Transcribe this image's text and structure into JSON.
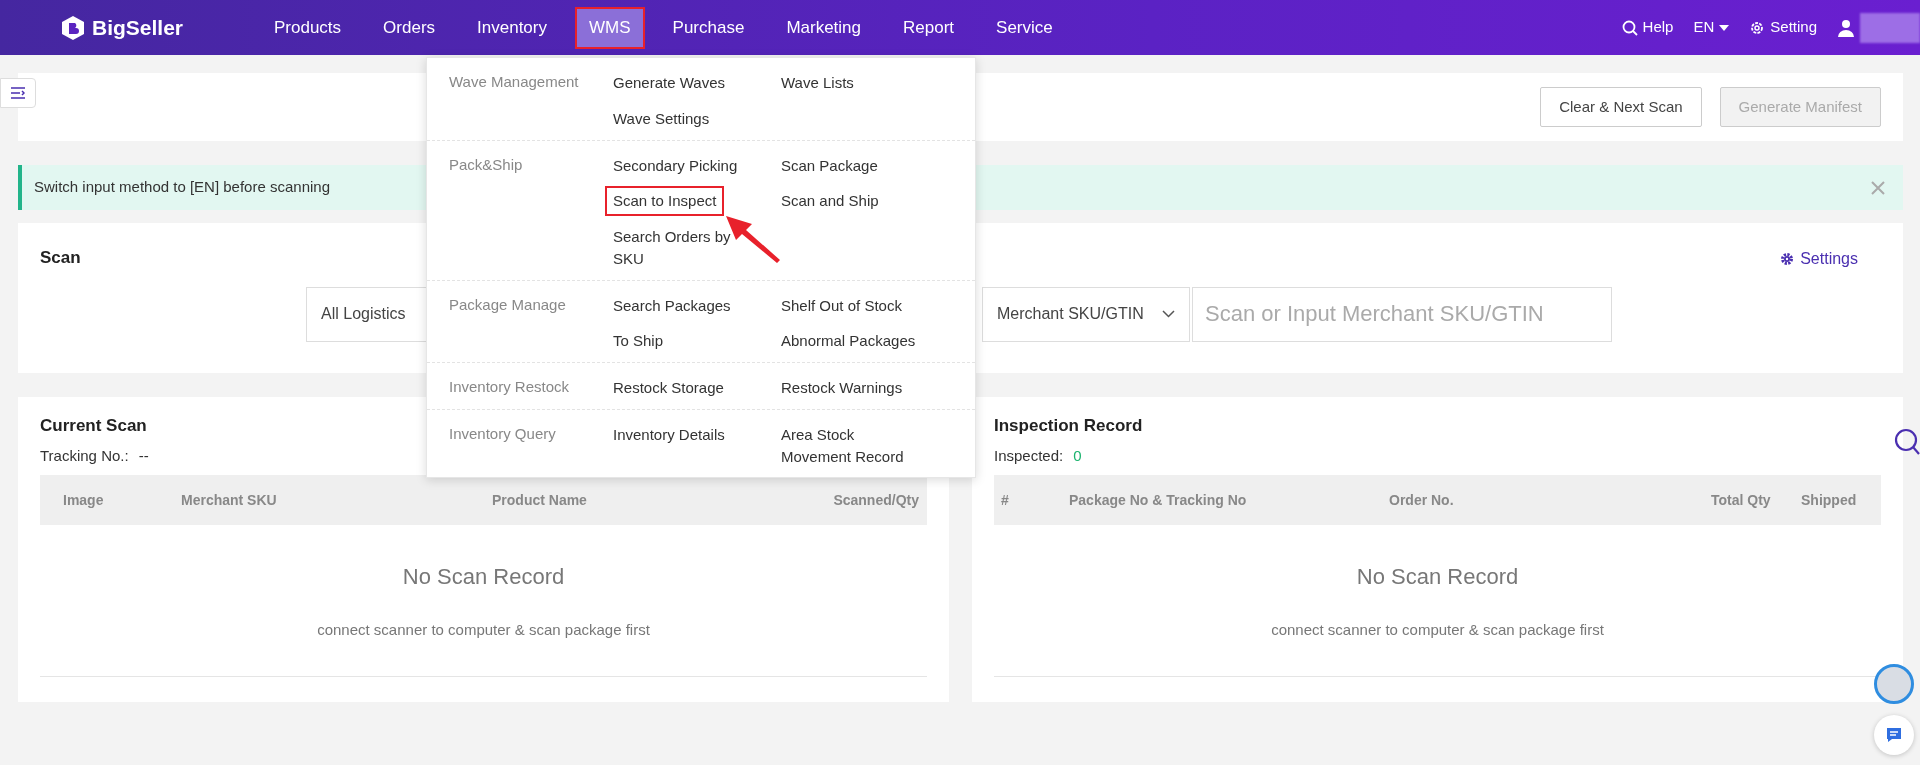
{
  "nav": {
    "logo": "BigSeller",
    "items": [
      {
        "label": "Products",
        "selected": false,
        "annotated": false
      },
      {
        "label": "Orders",
        "selected": false,
        "annotated": false
      },
      {
        "label": "Inventory",
        "selected": false,
        "annotated": false
      },
      {
        "label": "WMS",
        "selected": true,
        "annotated": true
      },
      {
        "label": "Purchase",
        "selected": false,
        "annotated": false
      },
      {
        "label": "Marketing",
        "selected": false,
        "annotated": false
      },
      {
        "label": "Report",
        "selected": false,
        "annotated": false
      },
      {
        "label": "Service",
        "selected": false,
        "annotated": false
      }
    ],
    "right": [
      {
        "kind": "help",
        "label": "Help"
      },
      {
        "kind": "language",
        "label": "EN"
      },
      {
        "kind": "setting",
        "label": "Setting"
      }
    ]
  },
  "toolbar": {
    "buttons": [
      {
        "label": "Clear & Next Scan",
        "disabled": false
      },
      {
        "label": "Generate Manifest",
        "disabled": true
      }
    ]
  },
  "alert": {
    "text": "Switch input method to [EN] before scanning"
  },
  "scan": {
    "title": "Scan",
    "settings_link": "Settings",
    "logistics_select": "All Logistics",
    "type_select": "Merchant SKU/GTIN",
    "input": {
      "placeholder": "Scan or Input Merchant SKU/GTIN"
    }
  },
  "current_scan": {
    "title": "Current Scan",
    "info_label": "Tracking No.:",
    "info_value": "--",
    "columns": [
      "Image",
      "Merchant SKU",
      "Product Name",
      "Scanned/Qty"
    ],
    "empty_title": "No Scan Record",
    "empty_hint": "connect scanner to computer & scan package first"
  },
  "inspection_record": {
    "title": "Inspection Record",
    "info_label": "Inspected:",
    "info_value": "0",
    "columns": [
      "#",
      "Package No & Tracking No",
      "Order No.",
      "Total Qty",
      "Shipped"
    ],
    "empty_title": "No Scan Record",
    "empty_hint": "connect scanner to computer & scan package first"
  },
  "wms_menu": {
    "groups": [
      {
        "label": "Wave Management",
        "items": [
          {
            "label": "Generate Waves",
            "annotated": false
          },
          {
            "label": "Wave Lists",
            "annotated": false
          },
          {
            "label": "Wave Settings",
            "annotated": false
          }
        ]
      },
      {
        "label": "Pack&Ship",
        "items": [
          {
            "label": "Secondary Picking",
            "annotated": false
          },
          {
            "label": "Scan Package",
            "annotated": false
          },
          {
            "label": "Scan to Inspect",
            "annotated": true
          },
          {
            "label": "Scan and Ship",
            "annotated": false
          },
          {
            "label": "Search Orders by SKU",
            "annotated": false
          }
        ]
      },
      {
        "label": "Package Manage",
        "items": [
          {
            "label": "Search Packages",
            "annotated": false
          },
          {
            "label": "Shelf Out of Stock",
            "annotated": false
          },
          {
            "label": "To Ship",
            "annotated": false
          },
          {
            "label": "Abnormal Packages",
            "annotated": false
          }
        ]
      },
      {
        "label": "Inventory Restock",
        "items": [
          {
            "label": "Restock Storage",
            "annotated": false
          },
          {
            "label": "Restock Warnings",
            "annotated": false
          }
        ]
      },
      {
        "label": "Inventory Query",
        "items": [
          {
            "label": "Inventory Details",
            "annotated": false
          },
          {
            "label": "Area Stock Movement Record",
            "annotated": false
          }
        ]
      }
    ]
  }
}
